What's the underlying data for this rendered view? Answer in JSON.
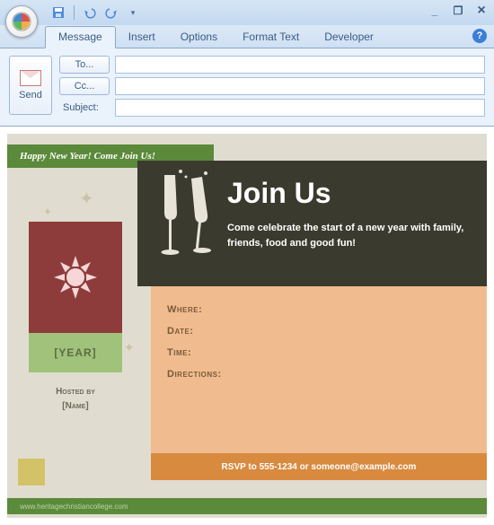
{
  "qat": {
    "save": "save-icon",
    "undo": "undo-icon",
    "redo": "redo-icon"
  },
  "win": {
    "min": "_",
    "max": "❐",
    "close": "×"
  },
  "ribbon": {
    "tabs": [
      "Message",
      "Insert",
      "Options",
      "Format Text",
      "Developer"
    ],
    "help": "?"
  },
  "compose": {
    "send": "Send",
    "to_btn": "To...",
    "cc_btn": "Cc...",
    "subject_label": "Subject:",
    "to_val": "",
    "cc_val": "",
    "subject_val": ""
  },
  "flyer": {
    "banner": "Happy New Year!  Come Join Us!",
    "title": "Join Us",
    "subtitle": "Come celebrate the start of a new year with family, friends, food and good fun!",
    "year": "[YEAR]",
    "hosted_label": "Hosted by",
    "hosted_name": "[Name]",
    "details": {
      "where": "Where:",
      "date": "Date:",
      "time": "Time:",
      "directions": "Directions:"
    },
    "rsvp": "RSVP to 555-1234 or someone@example.com",
    "footer": "www.heritagechristiancollege.com"
  },
  "colors": {
    "ribbon_bg": "#dce9f7",
    "accent_green": "#5a8a3a",
    "accent_dark": "#3a3a2e",
    "accent_red": "#8e3b3b",
    "accent_peach": "#f0bb8e",
    "accent_orange": "#d88a3f"
  }
}
